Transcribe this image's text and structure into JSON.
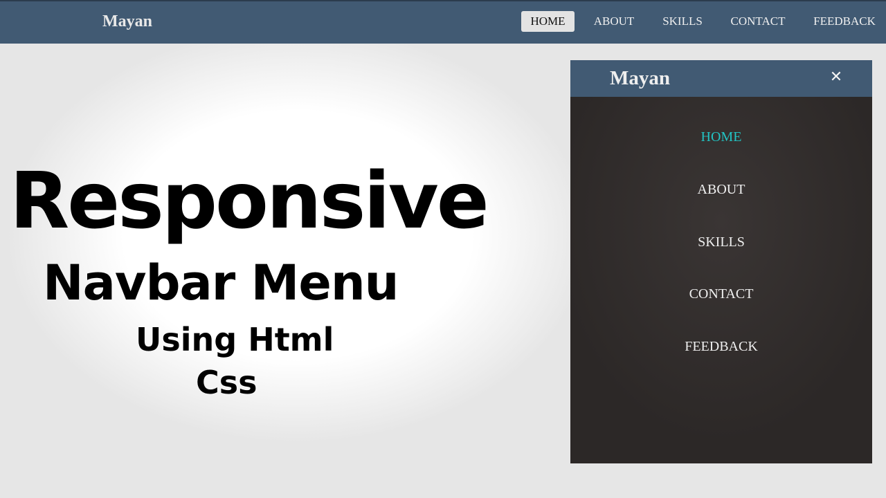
{
  "topbar": {
    "brand": "Mayan",
    "nav": [
      {
        "label": "HOME",
        "active": true
      },
      {
        "label": "ABOUT",
        "active": false
      },
      {
        "label": "SKILLS",
        "active": false
      },
      {
        "label": "CONTACT",
        "active": false
      },
      {
        "label": "FEEDBACK",
        "active": false
      }
    ]
  },
  "headline": {
    "line1": "Responsive",
    "line2": "Navbar Menu",
    "line3": "Using Html",
    "line4": "Css"
  },
  "mobile_menu": {
    "brand": "Mayan",
    "close_icon": "close-icon",
    "close_glyph": "✕",
    "items": [
      {
        "label": "HOME",
        "active": true
      },
      {
        "label": "ABOUT",
        "active": false
      },
      {
        "label": "SKILLS",
        "active": false
      },
      {
        "label": "CONTACT",
        "active": false
      },
      {
        "label": "FEEDBACK",
        "active": false
      }
    ]
  },
  "colors": {
    "navbar": "#415a73",
    "menu_background": "#2d2928",
    "active_link_mobile": "#22c3c3",
    "active_link_bg_desktop": "#e3e3e3"
  }
}
